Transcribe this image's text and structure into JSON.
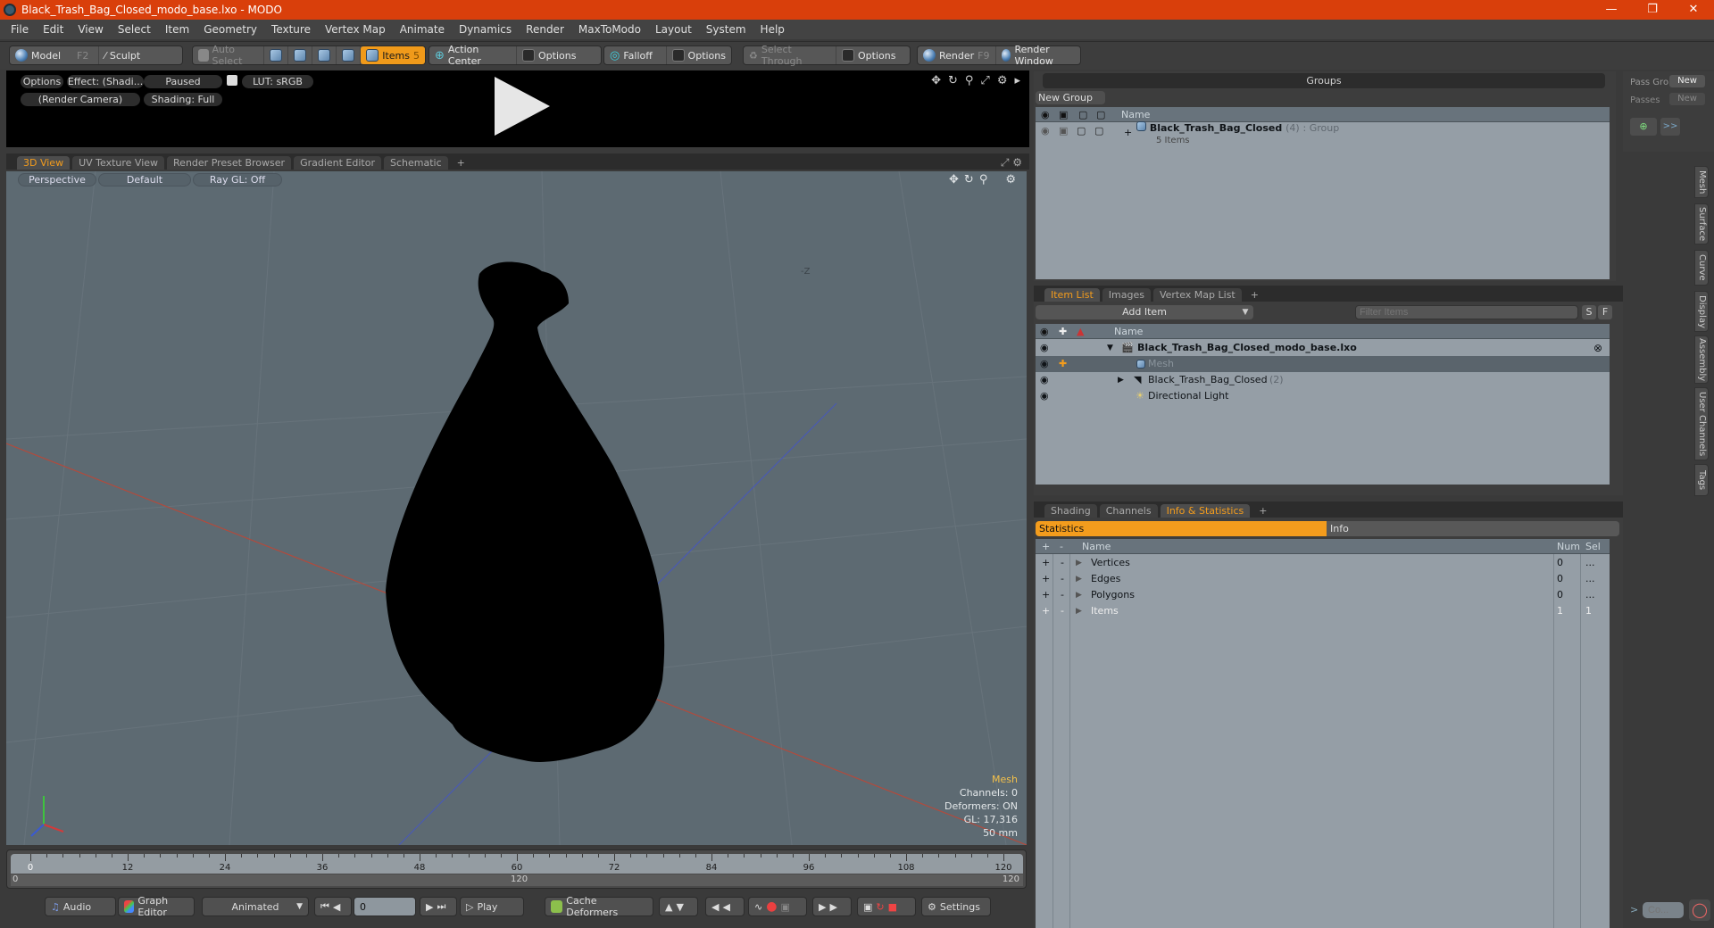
{
  "window": {
    "title": "Black_Trash_Bag_Closed_modo_base.lxo - MODO",
    "controls": [
      "minimize",
      "restore",
      "close"
    ]
  },
  "menu": [
    "File",
    "Edit",
    "View",
    "Select",
    "Item",
    "Geometry",
    "Texture",
    "Vertex Map",
    "Animate",
    "Dynamics",
    "Render",
    "MaxToModo",
    "Layout",
    "System",
    "Help"
  ],
  "toolbar": {
    "model": "Model",
    "model_key": "F2",
    "sculpt": "Sculpt",
    "auto_select": "Auto Select",
    "items": "Items",
    "items_count": "5",
    "action_center": "Action Center",
    "options1": "Options",
    "falloff": "Falloff",
    "options2": "Options",
    "select_through": "Select Through",
    "options3": "Options",
    "render": "Render",
    "render_key": "F9",
    "render_window": "Render Window"
  },
  "preview": {
    "options": "Options",
    "effect": "Effect: (Shadi...",
    "paused": "Paused",
    "lut": "LUT: sRGB",
    "camera": "(Render Camera)",
    "shading": "Shading: Full"
  },
  "viewport_tabs": [
    "3D View",
    "UV Texture View",
    "Render Preset Browser",
    "Gradient Editor",
    "Schematic",
    "+"
  ],
  "viewport": {
    "perspective": "Perspective",
    "default": "Default",
    "raygl": "Ray GL: Off",
    "axis_label_z": "-Z",
    "info": {
      "selection": "Mesh",
      "channels": "Channels: 0",
      "deformers": "Deformers: ON",
      "gl": "GL: 17,316",
      "units": "50 mm"
    }
  },
  "timeline": {
    "ticks": [
      "0",
      "12",
      "24",
      "36",
      "48",
      "60",
      "72",
      "84",
      "96",
      "108",
      "120"
    ],
    "range_start": "0",
    "range_mid": "120",
    "range_end": "120",
    "current_frame": 0
  },
  "bottombar": {
    "audio": "Audio",
    "graph_editor": "Graph Editor",
    "animated": "Animated",
    "frame": "0",
    "play": "Play",
    "cache": "Cache Deformers",
    "settings": "Settings"
  },
  "groups": {
    "title": "Groups",
    "new_group": "New Group",
    "col_name": "Name",
    "row": {
      "name": "Black_Trash_Bag_Closed",
      "count": "(4)",
      "type": ": Group",
      "sub": "5 Items"
    }
  },
  "passes": {
    "pass_group": "Pass Gro",
    "passes": "Passes",
    "new1": "New",
    "new2": "New"
  },
  "side_tabs": [
    "Mesh",
    "Surface",
    "Curve",
    "Display",
    "Assembly",
    "User Channels",
    "Tags"
  ],
  "itemlist": {
    "tabs": [
      "Item List",
      "Images",
      "Vertex Map List",
      "+"
    ],
    "add_item": "Add Item",
    "filter_placeholder": "Filter Items",
    "s_btn": "S",
    "f_btn": "F",
    "col_name": "Name",
    "rows": [
      {
        "name": "Black_Trash_Bag_Closed_modo_base.lxo",
        "count": "",
        "bold": true
      },
      {
        "name": "Mesh",
        "count": "",
        "selected": true
      },
      {
        "name": "Black_Trash_Bag_Closed",
        "count": "(2)"
      },
      {
        "name": "Directional Light",
        "count": ""
      }
    ]
  },
  "stats": {
    "tabs": [
      "Shading",
      "Channels",
      "Info & Statistics",
      "+"
    ],
    "sub_tabs": [
      "Statistics",
      "Info"
    ],
    "cols": [
      "Name",
      "Num",
      "Sel"
    ],
    "rows": [
      {
        "name": "Vertices",
        "num": "0",
        "sel": "..."
      },
      {
        "name": "Edges",
        "num": "0",
        "sel": "..."
      },
      {
        "name": "Polygons",
        "num": "0",
        "sel": "..."
      },
      {
        "name": "Items",
        "num": "1",
        "sel": "1"
      }
    ]
  },
  "command": {
    "placeholder": "Co...",
    "prompt": ">"
  },
  "colors": {
    "accent": "#f39c1d",
    "titlebar": "#d93f0b"
  }
}
